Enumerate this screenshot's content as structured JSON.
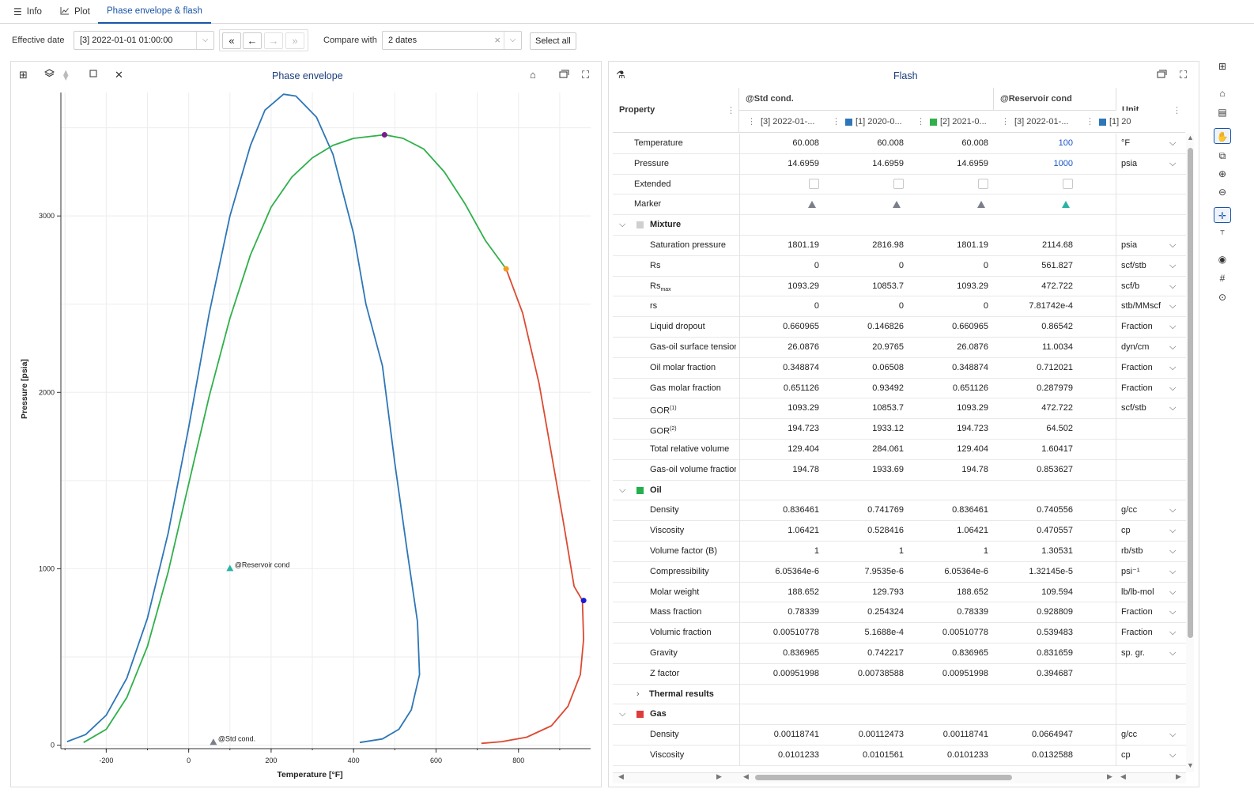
{
  "tabs": [
    {
      "label": "Info",
      "icon": "list-icon"
    },
    {
      "label": "Plot",
      "icon": "line-chart-icon"
    },
    {
      "label": "Phase envelope & flash",
      "icon": ""
    }
  ],
  "toolbar": {
    "effective_date_label": "Effective date",
    "effective_date_value": "[3] 2022-01-01 01:00:00",
    "compare_label": "Compare with",
    "compare_value": "2 dates",
    "select_all": "Select all",
    "nav": {
      "first": "«",
      "prev": "←",
      "next": "→",
      "last": "»"
    }
  },
  "phase_panel": {
    "title": "Phase envelope"
  },
  "flash_panel": {
    "title": "Flash"
  },
  "chart_data": {
    "type": "line",
    "title": "Phase envelope",
    "xlabel": "Temperature [°F]",
    "ylabel": "Pressure [psia]",
    "xlim": [
      -310,
      975
    ],
    "ylim": [
      -20,
      3700
    ],
    "xticks": [
      "-200",
      "0",
      "200",
      "400",
      "600",
      "800"
    ],
    "yticks": [
      "0",
      "1000",
      "2000",
      "3000"
    ],
    "series": [
      {
        "name": "",
        "color": "#2d76b7",
        "points": [
          [
            -295,
            20
          ],
          [
            -250,
            60
          ],
          [
            -200,
            170
          ],
          [
            -150,
            380
          ],
          [
            -100,
            720
          ],
          [
            -50,
            1200
          ],
          [
            0,
            1800
          ],
          [
            50,
            2450
          ],
          [
            100,
            3000
          ],
          [
            150,
            3400
          ],
          [
            185,
            3600
          ],
          [
            230,
            3690
          ],
          [
            260,
            3680
          ],
          [
            310,
            3560
          ],
          [
            350,
            3350
          ],
          [
            400,
            2900
          ],
          [
            430,
            2500
          ],
          [
            470,
            2150
          ],
          [
            500,
            1600
          ],
          [
            530,
            1100
          ],
          [
            555,
            700
          ],
          [
            560,
            400
          ],
          [
            540,
            200
          ],
          [
            510,
            90
          ],
          [
            470,
            35
          ],
          [
            415,
            15
          ]
        ]
      },
      {
        "name": "",
        "color": "#2fb04a",
        "points": [
          [
            -255,
            15
          ],
          [
            -200,
            90
          ],
          [
            -150,
            270
          ],
          [
            -100,
            560
          ],
          [
            -50,
            980
          ],
          [
            0,
            1480
          ],
          [
            50,
            1980
          ],
          [
            100,
            2420
          ],
          [
            150,
            2780
          ],
          [
            200,
            3050
          ],
          [
            250,
            3220
          ],
          [
            300,
            3330
          ],
          [
            350,
            3400
          ],
          [
            400,
            3440
          ],
          [
            475,
            3460
          ],
          [
            520,
            3440
          ],
          [
            570,
            3380
          ],
          [
            620,
            3250
          ],
          [
            670,
            3070
          ],
          [
            720,
            2860
          ],
          [
            770,
            2700
          ]
        ]
      },
      {
        "name": "",
        "color": "#dc4a32",
        "points": [
          [
            770,
            2700
          ],
          [
            810,
            2450
          ],
          [
            850,
            2050
          ],
          [
            880,
            1650
          ],
          [
            910,
            1250
          ],
          [
            935,
            900
          ],
          [
            955,
            820
          ],
          [
            958,
            600
          ],
          [
            950,
            400
          ],
          [
            920,
            220
          ],
          [
            880,
            110
          ],
          [
            820,
            45
          ],
          [
            760,
            20
          ],
          [
            710,
            10
          ]
        ]
      }
    ],
    "markers": [
      {
        "label": "",
        "x": 475,
        "y": 3460,
        "color": "#7a1a8c",
        "shape": "circle"
      },
      {
        "label": "",
        "x": 770,
        "y": 2700,
        "color": "#f0a020",
        "shape": "circle"
      },
      {
        "label": "",
        "x": 958,
        "y": 820,
        "color": "#1a1ad8",
        "shape": "circle"
      },
      {
        "label": "@Reservoir cond",
        "x": 100,
        "y": 1000,
        "color": "#29b3a4",
        "shape": "triangle"
      },
      {
        "label": "@Std cond.",
        "x": 60,
        "y": 14.7,
        "color": "#7a7f8a",
        "shape": "triangle"
      }
    ],
    "grid": true
  },
  "flash_table": {
    "headers": {
      "property": "Property",
      "std_group": "@Std cond.",
      "res_group": "@Reservoir cond",
      "unit": "Unit",
      "cols": [
        {
          "label": "[3] 2022-01-...",
          "color": ""
        },
        {
          "label": "[1] 2020-0...",
          "color": "#2d76b7"
        },
        {
          "label": "[2] 2021-0...",
          "color": "#2fb04a"
        },
        {
          "label": "[3] 2022-01-...",
          "color": ""
        },
        {
          "label": "[1] 20",
          "color": "#2d76b7"
        }
      ]
    },
    "rows": [
      {
        "kind": "row",
        "indent": 1,
        "name": "Temperature",
        "v": [
          "60.008",
          "60.008",
          "60.008",
          "100"
        ],
        "unit": "°F",
        "dd": true,
        "blue": true
      },
      {
        "kind": "row",
        "indent": 1,
        "name": "Pressure",
        "v": [
          "14.6959",
          "14.6959",
          "14.6959",
          "1000"
        ],
        "unit": "psia",
        "dd": true,
        "blue": true
      },
      {
        "kind": "check",
        "indent": 1,
        "name": "Extended"
      },
      {
        "kind": "marker",
        "indent": 1,
        "name": "Marker"
      },
      {
        "kind": "group",
        "name": "Mixture",
        "color": "#cfcfcf",
        "open": true
      },
      {
        "kind": "row",
        "indent": 2,
        "name": "Saturation pressure",
        "v": [
          "1801.19",
          "2816.98",
          "1801.19",
          "2114.68"
        ],
        "unit": "psia",
        "dd": true
      },
      {
        "kind": "row",
        "indent": 2,
        "name": "Rs",
        "v": [
          "0",
          "0",
          "0",
          "561.827"
        ],
        "unit": "scf/stb",
        "dd": true
      },
      {
        "kind": "row",
        "indent": 2,
        "name": "Rsmax",
        "v": [
          "1093.29",
          "10853.7",
          "1093.29",
          "472.722"
        ],
        "unit": "scf/b",
        "dd": true
      },
      {
        "kind": "row",
        "indent": 2,
        "name": "rs",
        "v": [
          "0",
          "0",
          "0",
          "7.81742e-4"
        ],
        "unit": "stb/MMscf",
        "dd": true
      },
      {
        "kind": "row",
        "indent": 2,
        "name": "Liquid dropout",
        "v": [
          "0.660965",
          "0.146826",
          "0.660965",
          "0.86542"
        ],
        "unit": "Fraction",
        "dd": true
      },
      {
        "kind": "row",
        "indent": 2,
        "name": "Gas-oil surface tension",
        "v": [
          "26.0876",
          "20.9765",
          "26.0876",
          "11.0034"
        ],
        "unit": "dyn/cm",
        "dd": true
      },
      {
        "kind": "row",
        "indent": 2,
        "name": "Oil molar fraction",
        "v": [
          "0.348874",
          "0.06508",
          "0.348874",
          "0.712021"
        ],
        "unit": "Fraction",
        "dd": true
      },
      {
        "kind": "row",
        "indent": 2,
        "name": "Gas molar fraction",
        "v": [
          "0.651126",
          "0.93492",
          "0.651126",
          "0.287979"
        ],
        "unit": "Fraction",
        "dd": true
      },
      {
        "kind": "row",
        "indent": 2,
        "name": "GOR(1)",
        "v": [
          "1093.29",
          "10853.7",
          "1093.29",
          "472.722"
        ],
        "unit": "scf/stb",
        "dd": true
      },
      {
        "kind": "row",
        "indent": 2,
        "name": "GOR(2)",
        "v": [
          "194.723",
          "1933.12",
          "194.723",
          "64.502"
        ],
        "unit": "",
        "dd": false
      },
      {
        "kind": "row",
        "indent": 2,
        "name": "Total relative volume",
        "v": [
          "129.404",
          "284.061",
          "129.404",
          "1.60417"
        ],
        "unit": "",
        "dd": false
      },
      {
        "kind": "row",
        "indent": 2,
        "name": "Gas-oil volume fraction",
        "v": [
          "194.78",
          "1933.69",
          "194.78",
          "0.853627"
        ],
        "unit": "",
        "dd": false
      },
      {
        "kind": "group",
        "name": "Oil",
        "color": "#22b04a",
        "open": true
      },
      {
        "kind": "row",
        "indent": 2,
        "name": "Density",
        "v": [
          "0.836461",
          "0.741769",
          "0.836461",
          "0.740556"
        ],
        "unit": "g/cc",
        "dd": true
      },
      {
        "kind": "row",
        "indent": 2,
        "name": "Viscosity",
        "v": [
          "1.06421",
          "0.528416",
          "1.06421",
          "0.470557"
        ],
        "unit": "cp",
        "dd": true
      },
      {
        "kind": "row",
        "indent": 2,
        "name": "Volume factor (B)",
        "v": [
          "1",
          "1",
          "1",
          "1.30531"
        ],
        "unit": "rb/stb",
        "dd": true
      },
      {
        "kind": "row",
        "indent": 2,
        "name": "Compressibility",
        "v": [
          "6.05364e-6",
          "7.9535e-6",
          "6.05364e-6",
          "1.32145e-5"
        ],
        "unit": "psi⁻¹",
        "dd": true
      },
      {
        "kind": "row",
        "indent": 2,
        "name": "Molar weight",
        "v": [
          "188.652",
          "129.793",
          "188.652",
          "109.594"
        ],
        "unit": "lb/lb-mol",
        "dd": true
      },
      {
        "kind": "row",
        "indent": 2,
        "name": "Mass fraction",
        "v": [
          "0.78339",
          "0.254324",
          "0.78339",
          "0.928809"
        ],
        "unit": "Fraction",
        "dd": true
      },
      {
        "kind": "row",
        "indent": 2,
        "name": "Volumic fraction",
        "v": [
          "0.00510778",
          "5.1688e-4",
          "0.00510778",
          "0.539483"
        ],
        "unit": "Fraction",
        "dd": true
      },
      {
        "kind": "row",
        "indent": 2,
        "name": "Gravity",
        "v": [
          "0.836965",
          "0.742217",
          "0.836965",
          "0.831659"
        ],
        "unit": "sp. gr.",
        "dd": true
      },
      {
        "kind": "row",
        "indent": 2,
        "name": "Z factor",
        "v": [
          "0.00951998",
          "0.00738588",
          "0.00951998",
          "0.394687"
        ],
        "unit": "",
        "dd": false
      },
      {
        "kind": "group",
        "name": "Thermal results",
        "color": "",
        "open": false
      },
      {
        "kind": "group",
        "name": "Gas",
        "color": "#e03a3a",
        "open": true
      },
      {
        "kind": "row",
        "indent": 2,
        "name": "Density",
        "v": [
          "0.00118741",
          "0.00112473",
          "0.00118741",
          "0.0664947"
        ],
        "unit": "g/cc",
        "dd": true
      },
      {
        "kind": "row",
        "indent": 2,
        "name": "Viscosity",
        "v": [
          "0.0101233",
          "0.0101561",
          "0.0101233",
          "0.0132588"
        ],
        "unit": "cp",
        "dd": true
      }
    ]
  }
}
